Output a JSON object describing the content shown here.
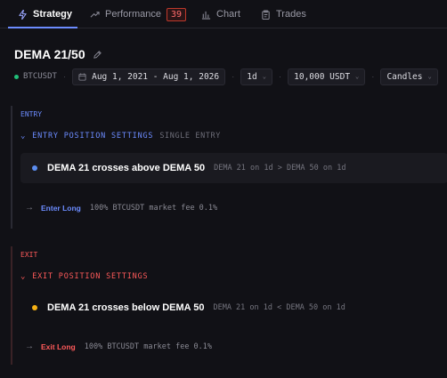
{
  "tabs": [
    {
      "label": "Strategy",
      "icon": "lightning-icon",
      "active": true
    },
    {
      "label": "Performance",
      "icon": "trend-icon",
      "badge": "39"
    },
    {
      "label": "Chart",
      "icon": "bar-chart-icon"
    },
    {
      "label": "Trades",
      "icon": "clipboard-icon"
    }
  ],
  "strategy": {
    "title": "DEMA 21/50",
    "symbol": "BTCUSDT",
    "date_range": "Aug 1, 2021 - Aug 1, 2026",
    "interval": "1d",
    "capital": "10,000 USDT",
    "chart_type": "Candles"
  },
  "entry": {
    "label": "ENTRY",
    "header": "ENTRY POSITION SETTINGS",
    "mode": "SINGLE ENTRY",
    "condition_name": "DEMA 21 crosses above DEMA 50",
    "condition_expr": "DEMA 21 on 1d > DEMA 50 on 1d",
    "action_name": "Enter Long",
    "action_desc": "100% BTCUSDT market fee 0.1%"
  },
  "exit": {
    "label": "EXIT",
    "header": "EXIT POSITION SETTINGS",
    "condition_name": "DEMA 21 crosses below DEMA 50",
    "condition_expr": "DEMA 21 on 1d < DEMA 50 on 1d",
    "action_name": "Exit Long",
    "action_desc": "100% BTCUSDT market fee 0.1%"
  },
  "colors": {
    "accent": "#6c8cff",
    "exit": "#ff5a5a",
    "status_green": "#21c07a",
    "entry_bullet": "#5b8def",
    "exit_bullet": "#f5b014"
  }
}
